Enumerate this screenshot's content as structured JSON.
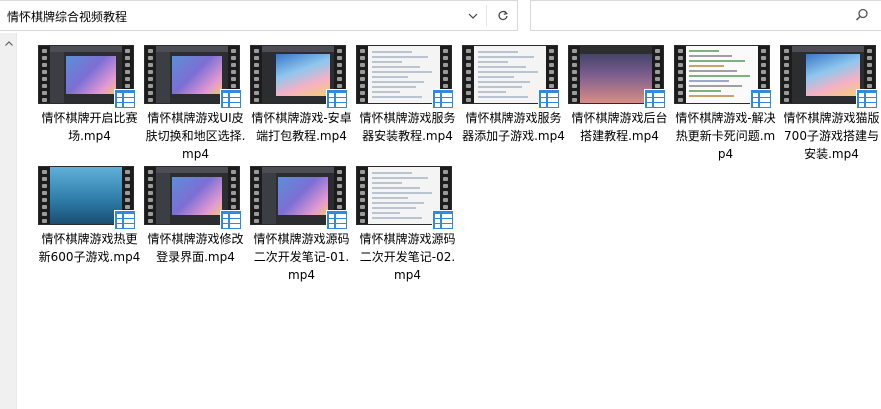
{
  "address": {
    "path": "情怀棋牌综合视频教程",
    "chevron_icon": "chevron-down-icon",
    "refresh_icon": "refresh-icon"
  },
  "search": {
    "placeholder": "",
    "icon": "search-icon"
  },
  "scrollbar": {
    "up_icon": "scroll-up-arrow-icon"
  },
  "files": [
    {
      "name": "情怀棋牌开启比赛场.mp4",
      "thumb": "dark-game"
    },
    {
      "name": "情怀棋牌游戏UI皮肤切换和地区选择.mp4",
      "thumb": "dark-game"
    },
    {
      "name": "情怀棋牌游戏-安卓端打包教程.mp4",
      "thumb": "game-bright"
    },
    {
      "name": "情怀棋牌游戏服务器安装教程.mp4",
      "thumb": "white-doc"
    },
    {
      "name": "情怀棋牌游戏服务器添加子游戏.mp4",
      "thumb": "white-doc"
    },
    {
      "name": "情怀棋牌游戏后台搭建教程.mp4",
      "thumb": "sunset"
    },
    {
      "name": "情怀棋牌游戏-解决热更新卡死问题.mp4",
      "thumb": "editor"
    },
    {
      "name": "情怀棋牌游戏猫版700子游戏搭建与安装.mp4",
      "thumb": "game-bright"
    },
    {
      "name": "情怀棋牌游戏热更新600子游戏.mp4",
      "thumb": "ocean"
    },
    {
      "name": "情怀棋牌游戏修改登录界面.mp4",
      "thumb": "dark-game"
    },
    {
      "name": "情怀棋牌游戏源码二次开发笔记-01.mp4",
      "thumb": "dark-game"
    },
    {
      "name": "情怀棋牌游戏源码二次开发笔记-02.mp4",
      "thumb": "white-doc"
    }
  ]
}
